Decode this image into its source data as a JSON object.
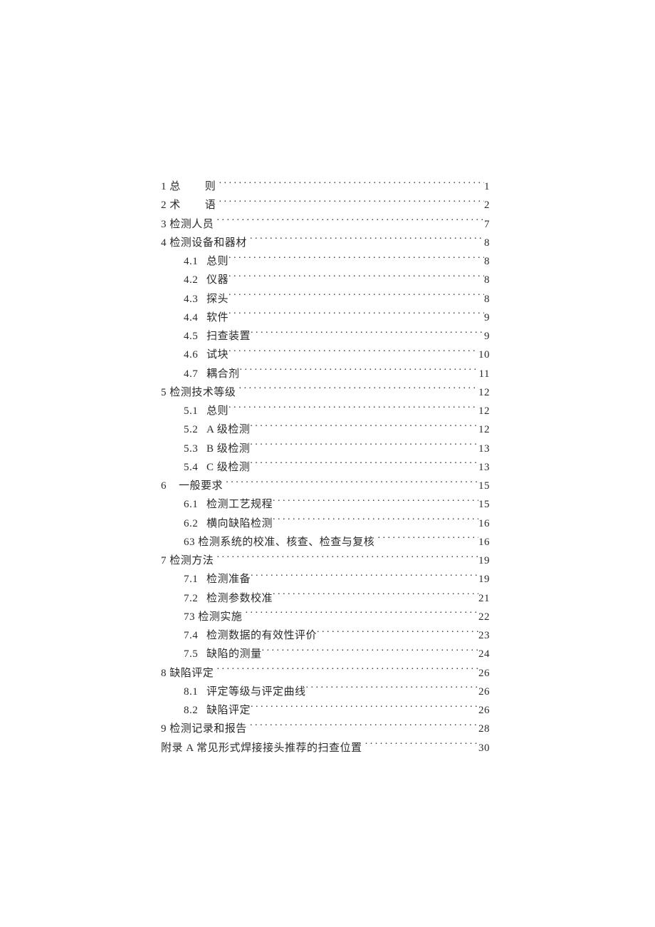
{
  "toc": [
    {
      "level": 1,
      "num": "1",
      "title": "总",
      "title2": "则",
      "spaced": true,
      "page": "1"
    },
    {
      "level": 1,
      "num": "2",
      "title": "术",
      "title2": "语",
      "spaced": true,
      "page": "2"
    },
    {
      "level": 1,
      "num": "3",
      "title": "检测人员",
      "page": "7"
    },
    {
      "level": 1,
      "num": "4",
      "title": "检测设备和器材",
      "page": "8"
    },
    {
      "level": 2,
      "num": "4.1",
      "title": "总则",
      "page": "8"
    },
    {
      "level": 2,
      "num": "4.2",
      "title": "仪器",
      "page": "8"
    },
    {
      "level": 2,
      "num": "4.3",
      "title": "探头",
      "page": "8"
    },
    {
      "level": 2,
      "num": "4.4",
      "title": "软件",
      "page": "9"
    },
    {
      "level": 2,
      "num": "4.5",
      "title": "扫查装置",
      "page": "9"
    },
    {
      "level": 2,
      "num": "4.6",
      "title": "试块",
      "page": "10"
    },
    {
      "level": 2,
      "num": "4.7",
      "title": "耦合剂",
      "page": "11"
    },
    {
      "level": 1,
      "num": "5",
      "title": "检测技术等级",
      "page": "12"
    },
    {
      "level": 2,
      "num": "5.1",
      "title": "总则",
      "page": "12"
    },
    {
      "level": 2,
      "num": "5.2",
      "title": "A 级检测",
      "page": "12"
    },
    {
      "level": 2,
      "num": "5.3",
      "title": "B 级检测",
      "page": "13"
    },
    {
      "level": 2,
      "num": "5.4",
      "title": "C 级检测",
      "page": "13"
    },
    {
      "level": 1,
      "num": "6",
      "title": "一般要求",
      "page": "15",
      "wide": true
    },
    {
      "level": 2,
      "num": "6.1",
      "title": "检测工艺规程",
      "page": "15"
    },
    {
      "level": 2,
      "num": "6.2",
      "title": "横向缺陷检测",
      "page": "16"
    },
    {
      "level": 2,
      "num": "63",
      "title": "检测系统的校准、核查、检查与复核",
      "page": "16",
      "nonumgap": true
    },
    {
      "level": 1,
      "num": "7",
      "title": "检测方法",
      "page": "19"
    },
    {
      "level": 2,
      "num": "7.1",
      "title": "检测准备",
      "page": "19"
    },
    {
      "level": 2,
      "num": "7.2",
      "title": "检测参数校准",
      "page": "21"
    },
    {
      "level": 2,
      "num": "73",
      "title": "检测实施",
      "page": "22",
      "nonumgap": true
    },
    {
      "level": 2,
      "num": "7.4",
      "title": "检测数据的有效性评价",
      "page": "23"
    },
    {
      "level": 2,
      "num": "7.5",
      "title": "缺陷的测量",
      "page": "24"
    },
    {
      "level": 1,
      "num": "8",
      "title": "缺陷评定",
      "page": "26"
    },
    {
      "level": 2,
      "num": "8.1",
      "title": "评定等级与评定曲线",
      "page": "26"
    },
    {
      "level": 2,
      "num": "8.2",
      "title": "缺陷评定",
      "page": "26"
    },
    {
      "level": 1,
      "num": "9",
      "title": "检测记录和报告",
      "page": "28"
    },
    {
      "level": 1,
      "num": "",
      "title": "附录 A 常见形式焊接接头推荐的扫查位置",
      "page": "30"
    }
  ]
}
